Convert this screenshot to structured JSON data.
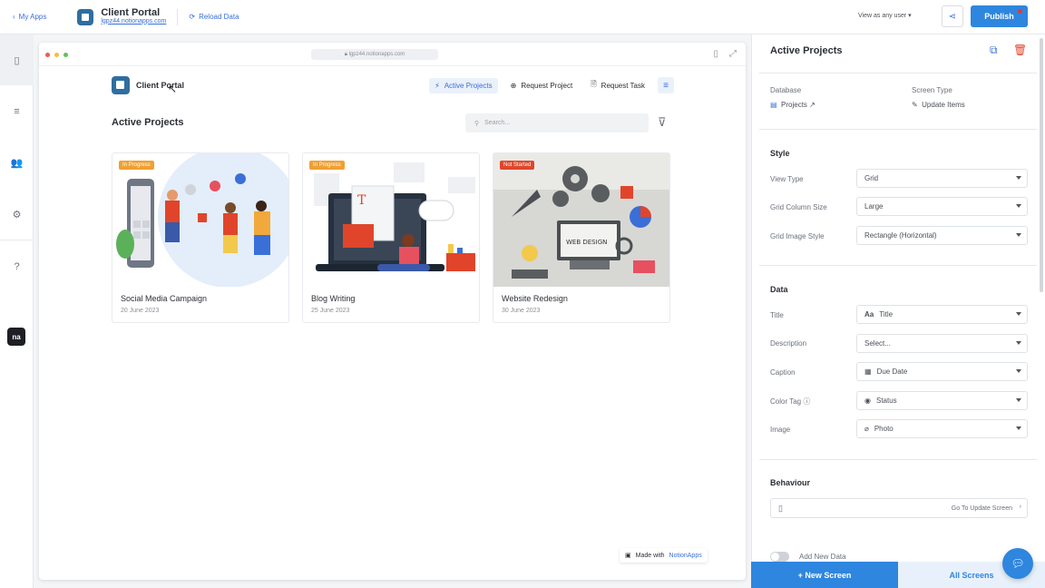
{
  "topbar": {
    "back_label": "My Apps",
    "app_title": "Client Portal",
    "app_url": "lgpz44.notionapps.com",
    "reload_label": "Reload Data",
    "view_as": "View as any user",
    "publish_label": "Publish"
  },
  "browser": {
    "url": "lgpz44.notionapps.com"
  },
  "portal": {
    "title": "Client Portal",
    "nav": [
      "Active Projects",
      "Request Project",
      "Request Task"
    ],
    "section_title": "Active Projects",
    "search_placeholder": "Search...",
    "cards": [
      {
        "status": "In Progress",
        "status_color": "#f0a033",
        "name": "Social Media Campaign",
        "date": "20 June 2023"
      },
      {
        "status": "In Progress",
        "status_color": "#f0a033",
        "name": "Blog Writing",
        "date": "25 June 2023"
      },
      {
        "status": "Not Started",
        "status_color": "#e0462b",
        "name": "Website Redesign",
        "date": "30 June 2023"
      }
    ],
    "made_with": "Made with",
    "made_with_brand": "NotionApps"
  },
  "panel": {
    "title": "Active Projects",
    "database_label": "Database",
    "database_value": "Projects",
    "screen_type_label": "Screen Type",
    "screen_type_value": "Update Items",
    "style_title": "Style",
    "view_type_label": "View Type",
    "view_type_value": "Grid",
    "grid_col_label": "Grid Column Size",
    "grid_col_value": "Large",
    "grid_img_label": "Grid Image Style",
    "grid_img_value": "Rectangle (Horizontal)",
    "data_title": "Data",
    "title_label": "Title",
    "title_value": "Title",
    "title_prefix": "Aa",
    "desc_label": "Description",
    "desc_value": "Select...",
    "caption_label": "Caption",
    "caption_value": "Due Date",
    "color_tag_label": "Color Tag",
    "color_tag_value": "Status",
    "image_label": "Image",
    "image_value": "Photo",
    "behaviour_title": "Behaviour",
    "behaviour_action": "Go To Update Screen",
    "add_new_label": "Add New Data"
  },
  "footer": {
    "new_screen": "+ New Screen",
    "all_screens": "All Screens"
  },
  "colors": {
    "accent": "#2e86de",
    "link": "#3a6fd8"
  }
}
